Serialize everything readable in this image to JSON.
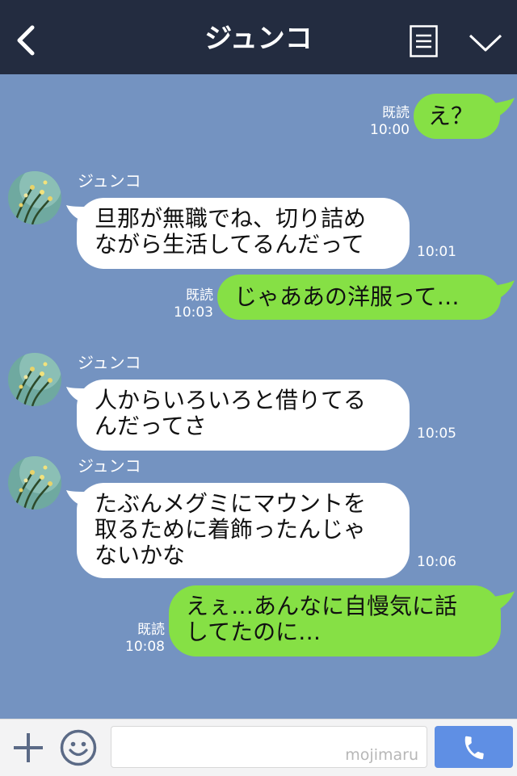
{
  "header": {
    "title": "ジュンコ",
    "back_icon": "back-arrow-icon",
    "menu_icon": "menu-icon",
    "chevron_icon": "chevron-down-icon"
  },
  "messages": [
    {
      "side": "right",
      "text": "え？",
      "read": "既読",
      "time": "10:00"
    },
    {
      "side": "left",
      "sender": "ジュンコ",
      "lines": [
        "旦那が無職でね、切り詰め",
        "ながら生活してるんだって"
      ],
      "time": "10:01"
    },
    {
      "side": "right",
      "text": "じゃああの洋服って…",
      "read": "既読",
      "time": "10:03"
    },
    {
      "side": "left",
      "sender": "ジュンコ",
      "lines": [
        "人からいろいろと借りてる",
        "んだってさ"
      ],
      "time": "10:05"
    },
    {
      "side": "left",
      "sender": "ジュンコ",
      "lines": [
        "たぶんメグミにマウントを",
        "取るために着飾ったんじゃ",
        "ないかな"
      ],
      "time": "10:06"
    },
    {
      "side": "right",
      "lines": [
        "えぇ…あんなに自慢気に話",
        "してたのに…"
      ],
      "read": "既読",
      "time": "10:08"
    }
  ],
  "footer": {
    "watermark": "mojimaru",
    "plus_icon": "plus-icon",
    "emoji_icon": "smiley-icon",
    "call_icon": "phone-icon"
  },
  "colors": {
    "header_bg": "#232c40",
    "chat_bg": "#7493c1",
    "green_bubble": "#86e045",
    "white_bubble": "#ffffff",
    "call_button": "#5f8fe4"
  }
}
